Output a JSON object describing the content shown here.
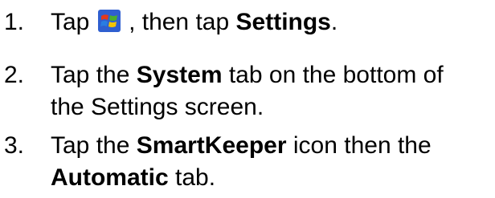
{
  "steps": [
    {
      "number": "1.",
      "t1": "Tap",
      "icon": "windows-start-icon",
      "t2": ", then tap",
      "b1": "Settings",
      "t3": "."
    },
    {
      "number": "2.",
      "t1": "Tap the",
      "b1": "System",
      "t2": "tab on the bottom of",
      "line2": "the Settings screen."
    },
    {
      "number": "3.",
      "t1": "Tap the",
      "b1": "SmartKeeper",
      "t2": "icon then the",
      "b2": "Automatic",
      "t3": "tab."
    }
  ],
  "colors": {
    "text": "#000000",
    "icon_bg": "#2f5fd0",
    "icon_red": "#e4391b",
    "icon_green": "#4caf2c",
    "icon_blue": "#2a7de1",
    "icon_yellow": "#f5c400"
  }
}
